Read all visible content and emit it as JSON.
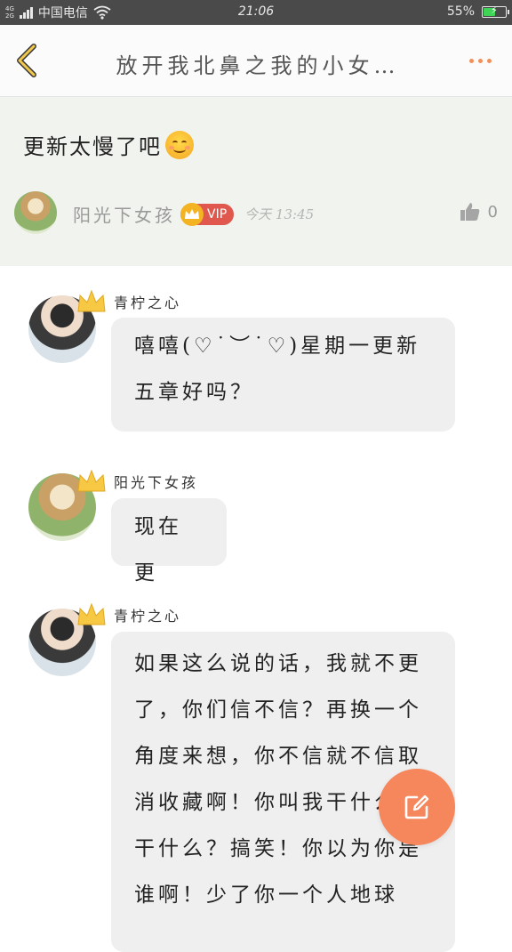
{
  "status_bar": {
    "network_top": "4G",
    "network_bottom": "2G",
    "carrier": "中国电信",
    "time": "21:06",
    "battery": "55%",
    "battery_level": 0.55,
    "battery_color": "#3fd455"
  },
  "nav": {
    "title": "放开我北鼻之我的小女…",
    "back_icon": "chevron-left-icon",
    "more_icon": "more-dots-icon",
    "accent": "#f0905a"
  },
  "post": {
    "text": "更新太慢了吧",
    "emoji": "smile-emoji",
    "author": "阳光下女孩",
    "badge": "VIP",
    "time": "今天 13:45",
    "likes": "0"
  },
  "comments": [
    {
      "name": "青柠之心",
      "text": "嘻嘻(♡˙︶˙♡)星期一更新五章好吗？"
    },
    {
      "name": "阳光下女孩",
      "text": "现在更"
    },
    {
      "name": "青柠之心",
      "text": "如果这么说的话，我就不更了，你们信不信？再换一个角度来想，你不信就不信取消收藏啊！你叫我干什么就干什么？搞笑！你以为你是谁啊！少了你一个人地球"
    }
  ],
  "fab": {
    "icon": "edit-icon",
    "color": "#f6875c"
  }
}
